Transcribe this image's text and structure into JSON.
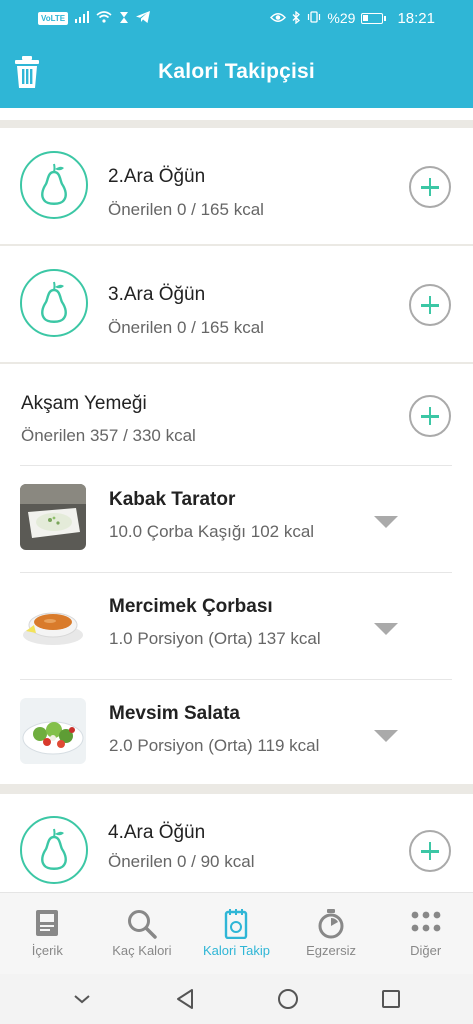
{
  "status_bar": {
    "network_badge": "VoLTE",
    "battery": "%29",
    "time": "18:21"
  },
  "app_bar": {
    "title": "Kalori Takipçisi"
  },
  "meals": [
    {
      "title": "2.Ara Öğün",
      "subtitle": "Önerilen 0 / 165 kcal",
      "icon": "pear-icon"
    },
    {
      "title": "3.Ara Öğün",
      "subtitle": "Önerilen 0 / 165 kcal",
      "icon": "pear-icon"
    }
  ],
  "dinner": {
    "title": "Akşam Yemeği",
    "subtitle": "Önerilen 357 / 330 kcal",
    "foods": [
      {
        "name": "Kabak Tarator",
        "detail": "10.0 Çorba Kaşığı 102 kcal"
      },
      {
        "name": "Mercimek Çorbası",
        "detail": "1.0 Porsiyon (Orta) 137 kcal"
      },
      {
        "name": "Mevsim Salata",
        "detail": "2.0 Porsiyon (Orta) 119 kcal"
      }
    ]
  },
  "snack4": {
    "title": "4.Ara Öğün",
    "subtitle": "Önerilen 0 / 90 kcal",
    "icon": "pear-icon"
  },
  "tabs": [
    {
      "label": "İçerik",
      "icon": "article-icon",
      "active": false
    },
    {
      "label": "Kaç Kalori",
      "icon": "search-icon",
      "active": false
    },
    {
      "label": "Kalori Takip",
      "icon": "tracker-icon",
      "active": true
    },
    {
      "label": "Egzersiz",
      "icon": "stopwatch-icon",
      "active": false
    },
    {
      "label": "Diğer",
      "icon": "more-dots-icon",
      "active": false
    }
  ],
  "colors": {
    "brand": "#2fb6d6",
    "accent_green": "#3cc7a5",
    "background": "#ebe9e4"
  }
}
